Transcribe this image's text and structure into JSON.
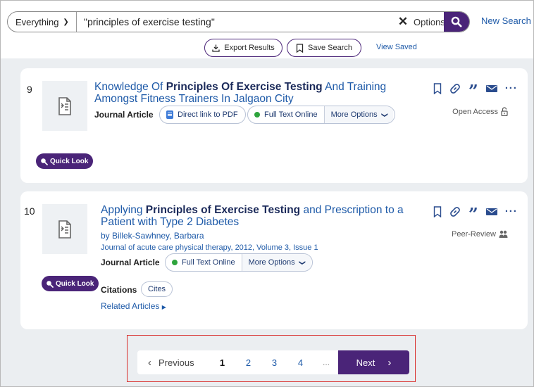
{
  "search": {
    "scope": "Everything",
    "query": "\"principles of exercise testing\"",
    "options_label": "Options",
    "new_search_label": "New Search"
  },
  "toolbar": {
    "export_label": "Export Results",
    "save_label": "Save Search",
    "view_saved_label": "View Saved"
  },
  "results": [
    {
      "number": "9",
      "title_parts": [
        "Knowledge Of ",
        "Principles Of Exercise Testing",
        " And Training Amongst Fitness Trainers In Jalgaon City"
      ],
      "type": "Journal Article",
      "direct_link_label": "Direct link to PDF",
      "fulltext_label": "Full Text Online",
      "more_options_label": "More Options",
      "access_label": "Open Access",
      "quick_look_label": "Quick Look"
    },
    {
      "number": "10",
      "title_parts": [
        "Applying ",
        "Principles of Exercise Testing",
        " and Prescription to a Patient with Type 2 Diabetes"
      ],
      "byline": "by Billek-Sawhney, Barbara",
      "journal": "Journal of acute care physical therapy, 2012, Volume 3, Issue 1",
      "type": "Journal Article",
      "fulltext_label": "Full Text Online",
      "more_options_label": "More Options",
      "access_label": "Peer-Review",
      "quick_look_label": "Quick Look",
      "citations_label": "Citations",
      "cites_label": "Cites",
      "related_label": "Related Articles"
    }
  ],
  "pagination": {
    "previous_label": "Previous",
    "pages": [
      "1",
      "2",
      "3",
      "4"
    ],
    "ellipsis": "...",
    "current_page": "1",
    "next_label": "Next"
  },
  "colors": {
    "brand_purple": "#4a2478",
    "link_blue": "#1e5aa8",
    "highlight_red": "#d9302e",
    "online_green": "#2ea43c"
  }
}
